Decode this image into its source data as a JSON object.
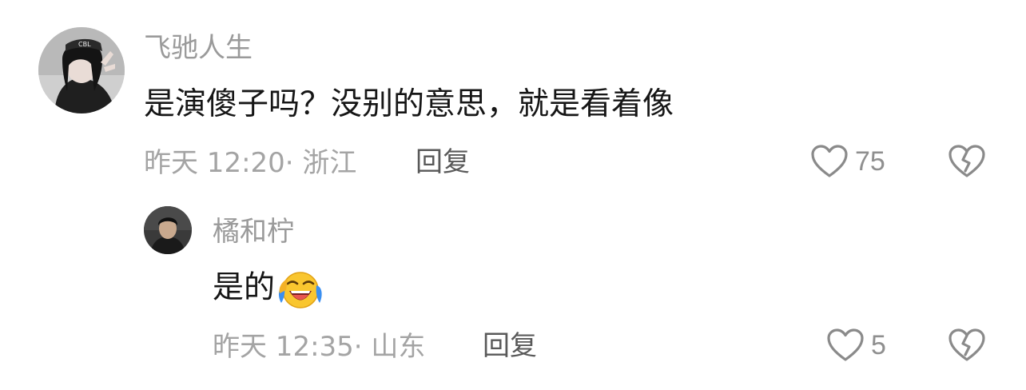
{
  "comments": [
    {
      "username": "飞驰人生",
      "text": "是演傻子吗？没别的意思，就是看着像",
      "time": "昨天 12:20",
      "separator": "·",
      "location": "浙江",
      "reply_label": "回复",
      "likes": "75",
      "avatar_icon": "user-avatar-photo"
    },
    {
      "username": "橘和柠",
      "text": "是的",
      "emoji": "loudly-crying-laughing-emoji",
      "time": "昨天 12:35",
      "separator": "·",
      "location": "山东",
      "reply_label": "回复",
      "likes": "5",
      "avatar_icon": "user-avatar-photo"
    }
  ],
  "icons": {
    "like": "heart-outline-icon",
    "dislike": "broken-heart-icon"
  },
  "colors": {
    "username": "#9a9a9a",
    "comment_text": "#161616",
    "meta_text": "#a4a4a4",
    "reply_text": "#595959",
    "icon_stroke": "#8a8a8a"
  }
}
